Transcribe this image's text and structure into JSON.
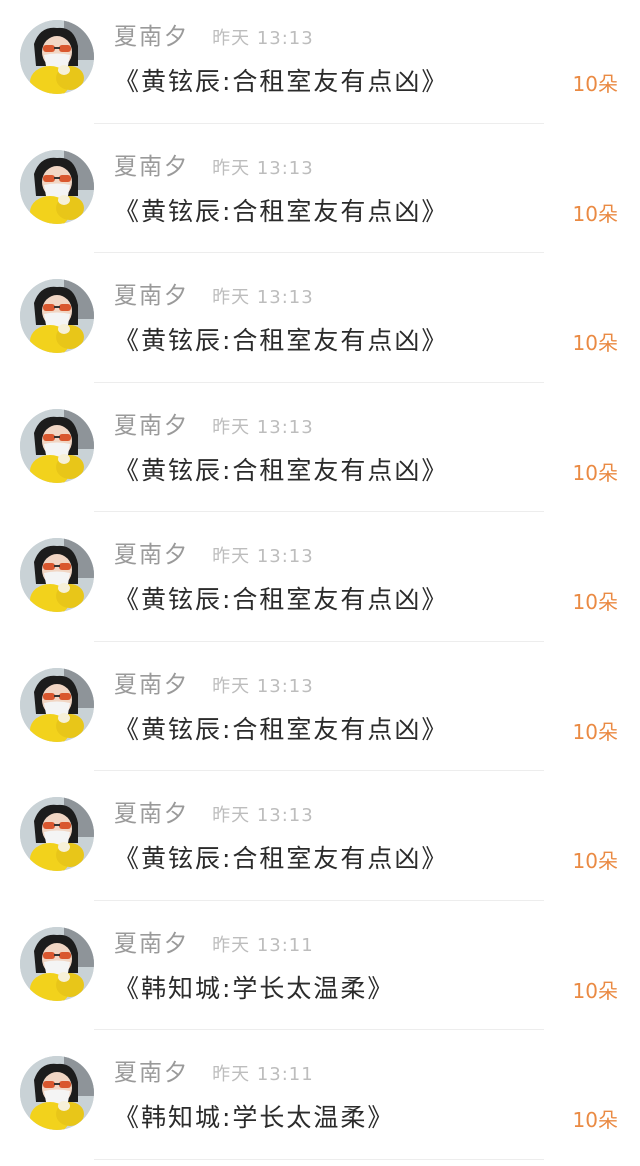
{
  "items": [
    {
      "name": "夏南夕",
      "time": "昨天 13:13",
      "title": "《黄铉辰:合租室友有点凶》",
      "count": "10朵"
    },
    {
      "name": "夏南夕",
      "time": "昨天 13:13",
      "title": "《黄铉辰:合租室友有点凶》",
      "count": "10朵"
    },
    {
      "name": "夏南夕",
      "time": "昨天 13:13",
      "title": "《黄铉辰:合租室友有点凶》",
      "count": "10朵"
    },
    {
      "name": "夏南夕",
      "time": "昨天 13:13",
      "title": "《黄铉辰:合租室友有点凶》",
      "count": "10朵"
    },
    {
      "name": "夏南夕",
      "time": "昨天 13:13",
      "title": "《黄铉辰:合租室友有点凶》",
      "count": "10朵"
    },
    {
      "name": "夏南夕",
      "time": "昨天 13:13",
      "title": "《黄铉辰:合租室友有点凶》",
      "count": "10朵"
    },
    {
      "name": "夏南夕",
      "time": "昨天 13:13",
      "title": "《黄铉辰:合租室友有点凶》",
      "count": "10朵"
    },
    {
      "name": "夏南夕",
      "time": "昨天 13:11",
      "title": "《韩知城:学长太温柔》",
      "count": "10朵"
    },
    {
      "name": "夏南夕",
      "time": "昨天 13:11",
      "title": "《韩知城:学长太温柔》",
      "count": "10朵"
    }
  ],
  "colors": {
    "name": "#9a9a9a",
    "time": "#bdbdbd",
    "title": "#2b2b2b",
    "count": "#ea8a43",
    "divider": "#ededed"
  },
  "icons": {
    "avatar": "user-avatar-photo"
  }
}
